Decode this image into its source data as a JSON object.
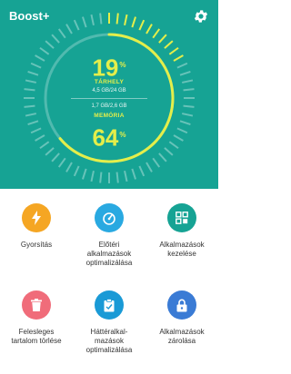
{
  "header": {
    "title": "Boost+",
    "settings_icon": "gear-icon"
  },
  "storage": {
    "percent": "19",
    "percent_symbol": "%",
    "label": "TÁRHELY",
    "detail": "4,5 GB/24 GB",
    "fraction": 0.19
  },
  "memory": {
    "percent": "64",
    "percent_symbol": "%",
    "label": "MEMÓRIA",
    "detail": "1,7 GB/2,6 GB",
    "fraction": 0.64
  },
  "colors": {
    "header_bg": "#16a394",
    "accent_yellow": "#e4ee4a",
    "orange": "#f5a623",
    "blue": "#29a9e1",
    "teal": "#16a394",
    "pink": "#f06c7a",
    "purple": "#3a7bd5"
  },
  "actions": [
    {
      "label": "Gyorsítás",
      "icon": "lightning-icon",
      "color": "#f5a623"
    },
    {
      "label": "Előtéri\nalkalmazások\noptimalizálása",
      "icon": "speedometer-icon",
      "color": "#29a9e1"
    },
    {
      "label": "Alkalmazások\nkezelése",
      "icon": "apps-grid-icon",
      "color": "#16a394"
    },
    {
      "label": "Felesleges\ntartalom törlése",
      "icon": "trash-icon",
      "color": "#f06c7a"
    },
    {
      "label": "Háttéralkal-\nmazások\noptimalizálása",
      "icon": "clipboard-check-icon",
      "color": "#1a9ad6"
    },
    {
      "label": "Alkalmazások\nzárolása",
      "icon": "lock-icon",
      "color": "#3a7bd5"
    }
  ]
}
